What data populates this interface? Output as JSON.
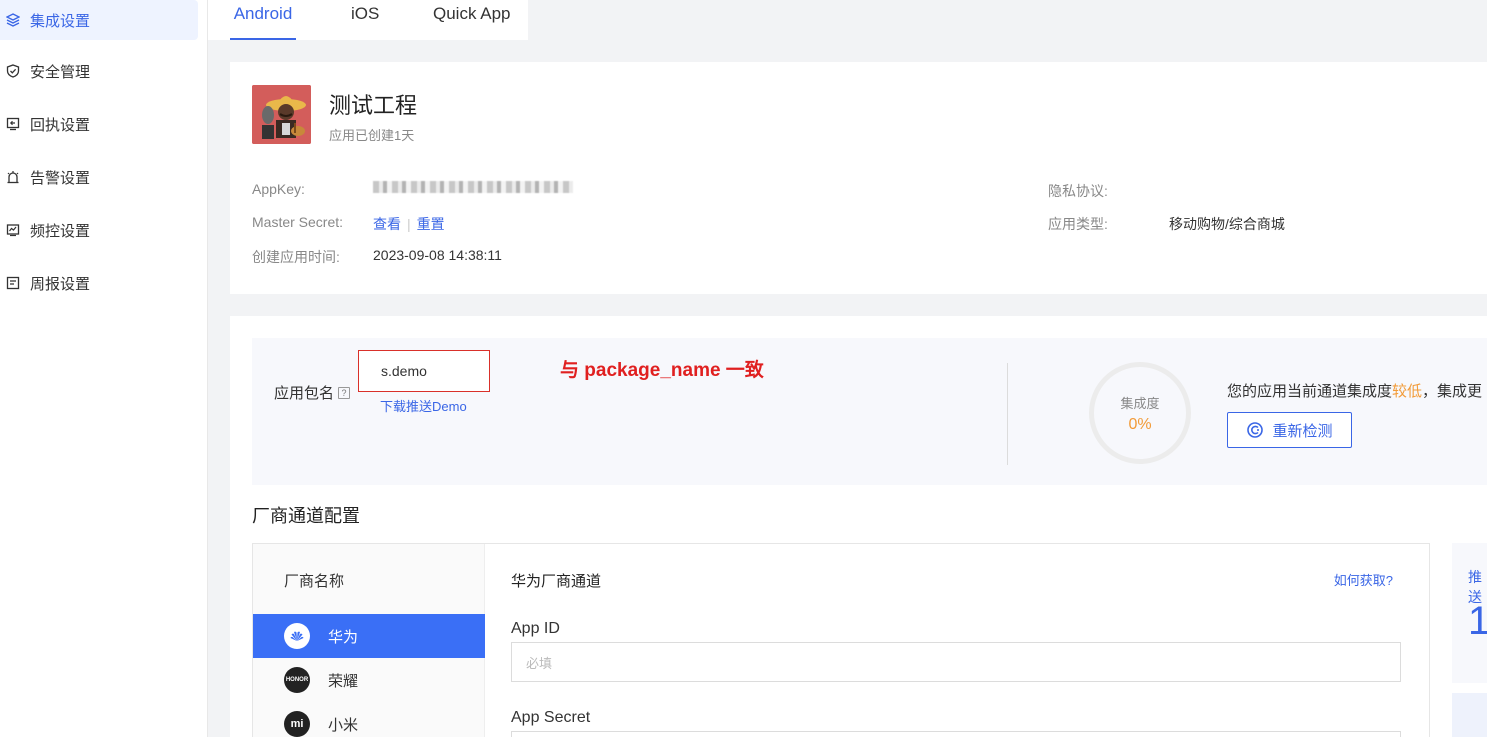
{
  "sidebar": {
    "items": [
      {
        "label": "集成设置",
        "icon": "layers-icon",
        "active": true
      },
      {
        "label": "安全管理",
        "icon": "shield-icon"
      },
      {
        "label": "回执设置",
        "icon": "receipt-icon"
      },
      {
        "label": "告警设置",
        "icon": "alarm-icon"
      },
      {
        "label": "频控设置",
        "icon": "frequency-icon"
      },
      {
        "label": "周报设置",
        "icon": "report-icon"
      }
    ]
  },
  "tabs": [
    "Android",
    "iOS",
    "Quick App"
  ],
  "app": {
    "name": "测试工程",
    "subtitle": "应用已创建1天",
    "appkey_label": "AppKey:",
    "master_secret_label": "Master Secret:",
    "master_secret_view": "查看",
    "master_secret_reset": "重置",
    "created_label": "创建应用时间:",
    "created_value": "2023-09-08 14:38:11",
    "privacy_label": "隐私协议:",
    "type_label": "应用类型:",
    "type_value": "移动购物/综合商城"
  },
  "package": {
    "label": "应用包名",
    "help": "?",
    "value": "s.demo",
    "demo_link": "下载推送Demo",
    "annotation": "与 package_name 一致"
  },
  "integration": {
    "gauge_label": "集成度",
    "gauge_value": "0%",
    "progress_percent": 0,
    "status_prefix": "您的应用当前通道集成度",
    "status_level": "较低",
    "status_suffix": "，集成更",
    "recheck_button": "重新检测"
  },
  "vendor_section": {
    "title": "厂商通道配置",
    "list_header": "厂商名称",
    "vendors": [
      {
        "label": "华为",
        "icon": "huawei-icon",
        "active": true
      },
      {
        "label": "荣耀",
        "icon": "honor-icon",
        "icon_text": "HONOR"
      },
      {
        "label": "小米",
        "icon": "xiaomi-icon",
        "icon_text": "mi"
      }
    ],
    "form_title": "华为厂商通道",
    "help_link": "如何获取?",
    "app_id_label": "App ID",
    "app_id_placeholder": "必填",
    "app_secret_label": "App Secret"
  },
  "right_stub": {
    "label": "推送",
    "value": "1"
  },
  "colors": {
    "accent": "#3a66e6",
    "warning": "#f29b38",
    "annotation": "#e02020"
  }
}
